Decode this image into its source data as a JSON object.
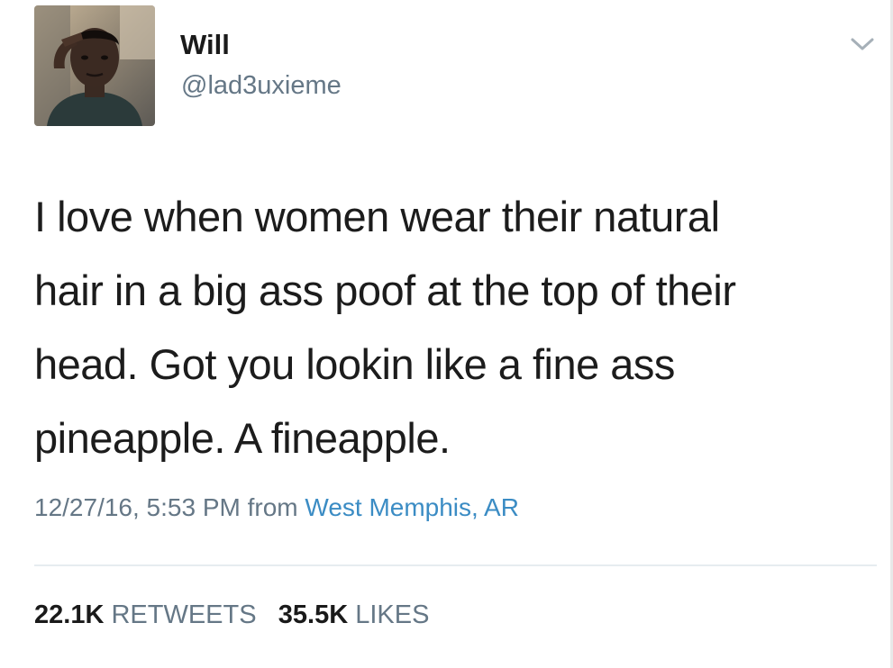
{
  "user": {
    "display_name": "Will",
    "handle": "@lad3uxieme"
  },
  "tweet": {
    "lines": [
      "I love when women wear their natural",
      "hair in a big ass poof at the top of their",
      "head. Got you lookin like a fine ass",
      "pineapple. A fineapple."
    ],
    "timestamp": "12/27/16, 5:53 PM",
    "from_label": "from",
    "location": "West Memphis, AR"
  },
  "stats": {
    "retweets_count": "22.1K",
    "retweets_label": "RETWEETS",
    "likes_count": "35.5K",
    "likes_label": "LIKES"
  },
  "icons": {
    "menu": "chevron-down-icon",
    "avatar": "profile-photo"
  },
  "colors": {
    "secondary_text": "#657786",
    "link": "#3b8cc4",
    "divider": "#e6ecf0"
  }
}
